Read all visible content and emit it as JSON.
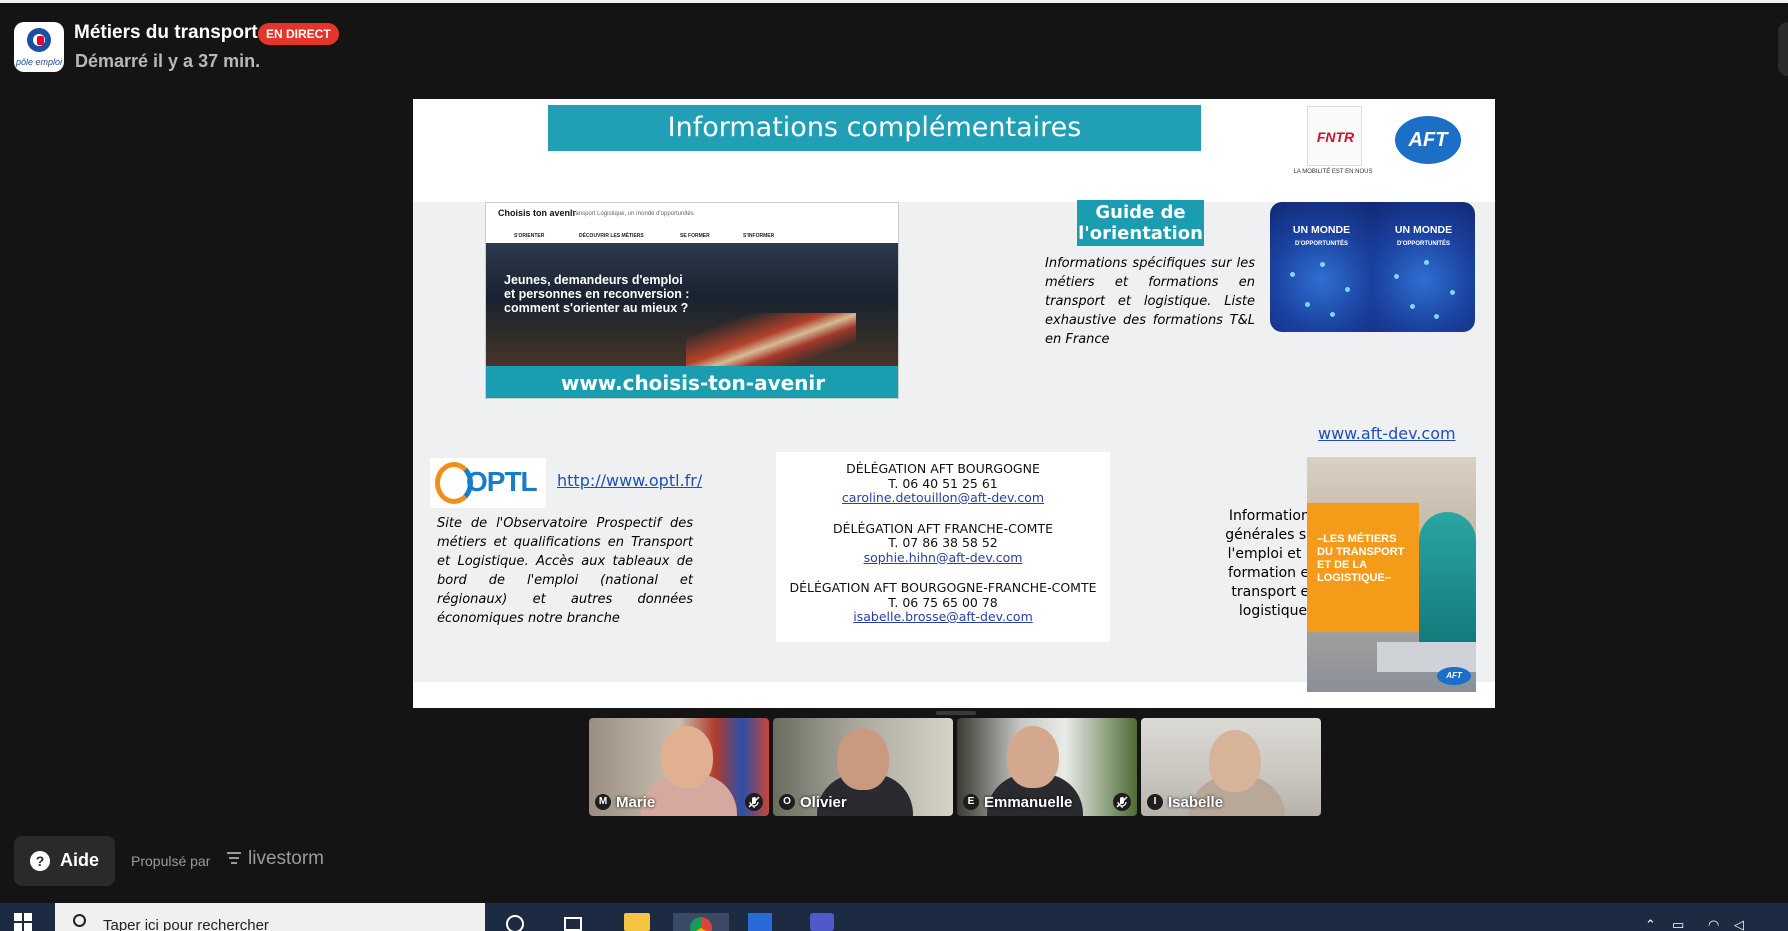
{
  "header": {
    "logo_text": "pôle emploi",
    "title": "Métiers du transport",
    "live_badge": "EN DIRECT",
    "started": "Démarré il y a 37 min."
  },
  "slide": {
    "title": "Informations complémentaires",
    "fntr_logo": "FNTR",
    "fntr_tagline": "LA MOBILITÉ EST EN NOUS",
    "aft_logo": "AFT",
    "choisis": {
      "brand": "Choisis ton avenir",
      "tagline": "Transport Logistique, un monde d'opportunités",
      "nav": [
        "S'ORIENTER",
        "DÉCOUVRIR LES MÉTIERS",
        "SE FORMER",
        "S'INFORMER"
      ],
      "hero_text": "Jeunes, demandeurs d'emploi et personnes en reconversion : comment s'orienter au mieux ?",
      "url": "www.choisis-ton-avenir"
    },
    "guide": {
      "title": "Guide de l'orientation",
      "text": "Informations spécifiques sur les métiers et formations en transport et logistique. Liste exhaustive des formations T&L en France",
      "book_title": "UN MONDE",
      "book_subtitle": "D'OPPORTUNITÉS"
    },
    "aft_link": "www.aft-dev.com",
    "optl": {
      "logo": "OPTL",
      "link": "http://www.optl.fr/",
      "text": "Site de l'Observatoire Prospectif des métiers et qualifications en Transport et Logistique. Accès aux tableaux de bord de l'emploi (national et régionaux) et autres données économiques notre branche"
    },
    "delegations": [
      {
        "name": "DÉLÉGATION AFT BOURGOGNE",
        "tel": "T. 06 40 51 25 61",
        "email": "caroline.detouillon@aft-dev.com"
      },
      {
        "name": "DÉLÉGATION AFT FRANCHE-COMTE",
        "tel": "T. 07 86 38 58 52",
        "email": "sophie.hihn@aft-dev.com"
      },
      {
        "name": "DÉLÉGATION AFT BOURGOGNE-FRANCHE-COMTE",
        "tel": "T. 06 75 65 00 78",
        "email": "isabelle.brosse@aft-dev.com"
      }
    ],
    "info_right": "Informations générales sur l'emploi et la formation en transport et logistique",
    "poster_title": "–LES MÉTIERS DU TRANSPORT ET DE LA LOGISTIQUE–"
  },
  "participants": [
    {
      "initial": "M",
      "name": "Marie",
      "muted": true
    },
    {
      "initial": "O",
      "name": "Olivier",
      "muted": false
    },
    {
      "initial": "E",
      "name": "Emmanuelle",
      "muted": true
    },
    {
      "initial": "I",
      "name": "Isabelle",
      "muted": false
    }
  ],
  "footer": {
    "help": "Aide",
    "powered_by": "Propulsé par",
    "brand": "livestorm"
  },
  "taskbar": {
    "search_placeholder": "Taper ici pour rechercher"
  },
  "colors": {
    "live": "#e5352b",
    "teal": "#1a9db1",
    "link": "#1f4fb5"
  }
}
